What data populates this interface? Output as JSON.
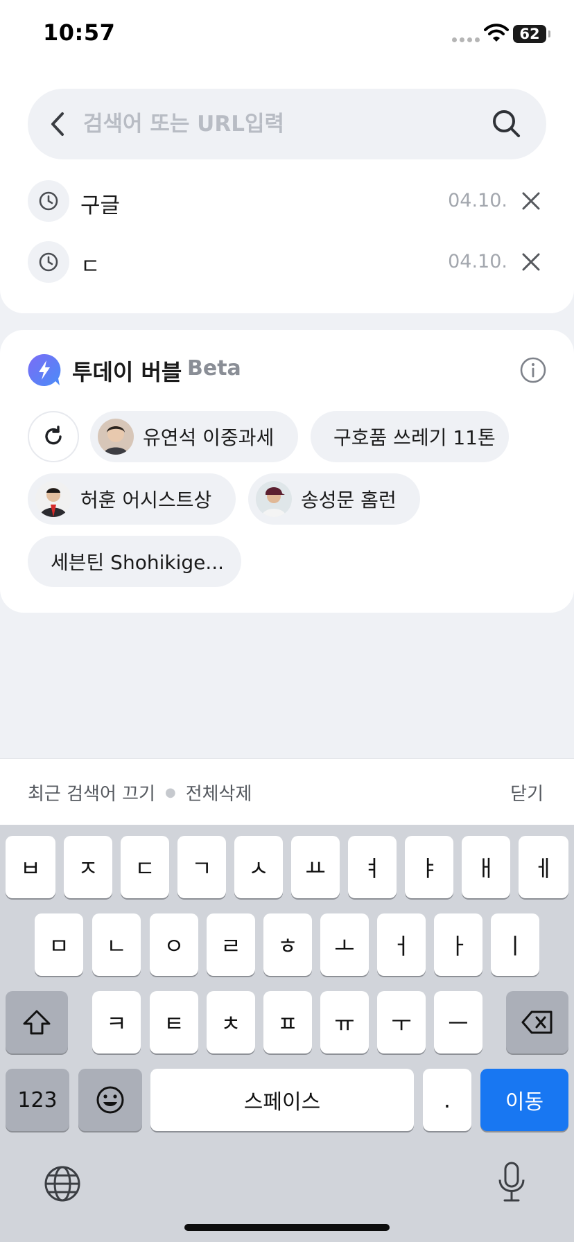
{
  "status_bar": {
    "time": "10:57",
    "battery": "62"
  },
  "search": {
    "placeholder": "검색어 또는 URL입력",
    "value": ""
  },
  "history": [
    {
      "term": "구글",
      "date": "04.10."
    },
    {
      "term": "ㄷ",
      "date": "04.10."
    }
  ],
  "today_bubble": {
    "title": "투데이 버블",
    "badge": "Beta",
    "chips": [
      {
        "label": "유연석 이중과세",
        "has_avatar": true
      },
      {
        "label": "구호품 쓰레기 11톤",
        "has_avatar": false
      },
      {
        "label": "허훈 어시스트상",
        "has_avatar": true
      },
      {
        "label": "송성문 홈런",
        "has_avatar": true
      },
      {
        "label": "세븐틴 Shohikige...",
        "has_avatar": false
      }
    ]
  },
  "actions": {
    "disable_recent": "최근 검색어 끄기",
    "delete_all": "전체삭제",
    "close": "닫기"
  },
  "keyboard": {
    "row1": [
      "ㅂ",
      "ㅈ",
      "ㄷ",
      "ㄱ",
      "ㅅ",
      "ㅛ",
      "ㅕ",
      "ㅑ",
      "ㅐ",
      "ㅔ"
    ],
    "row2": [
      "ㅁ",
      "ㄴ",
      "ㅇ",
      "ㄹ",
      "ㅎ",
      "ㅗ",
      "ㅓ",
      "ㅏ",
      "ㅣ"
    ],
    "row3": [
      "ㅋ",
      "ㅌ",
      "ㅊ",
      "ㅍ",
      "ㅠ",
      "ㅜ",
      "ㅡ"
    ],
    "numbers": "123",
    "space": "스페이스",
    "period": ".",
    "go": "이동"
  },
  "colors": {
    "accent_blue": "#1877f2",
    "bolt_gradient_start": "#7b6cf6",
    "bolt_gradient_end": "#4a8cf7"
  }
}
